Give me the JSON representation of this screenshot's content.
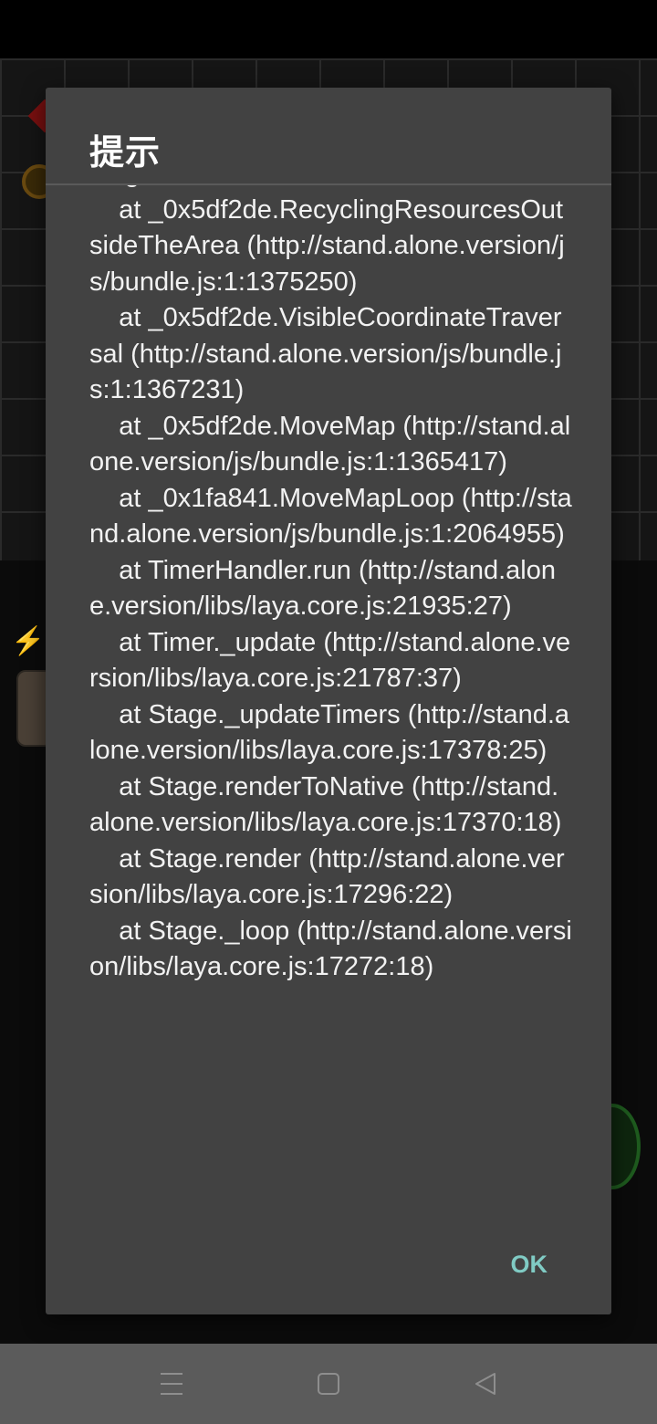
{
  "dialog": {
    "title": "提示",
    "message": "length of undefined\n    at _0x5df2de.RecyclingResourcesOutsideTheArea (http://stand.alone.version/js/bundle.js:1:1375250)\n    at _0x5df2de.VisibleCoordinateTraversal (http://stand.alone.version/js/bundle.js:1:1367231)\n    at _0x5df2de.MoveMap (http://stand.alone.version/js/bundle.js:1:1365417)\n    at _0x1fa841.MoveMapLoop (http://stand.alone.version/js/bundle.js:1:2064955)\n    at TimerHandler.run (http://stand.alone.version/libs/laya.core.js:21935:27)\n    at Timer._update (http://stand.alone.version/libs/laya.core.js:21787:37)\n    at Stage._updateTimers (http://stand.alone.version/libs/laya.core.js:17378:25)\n    at Stage.renderToNative (http://stand.alone.version/libs/laya.core.js:17370:18)\n    at Stage.render (http://stand.alone.version/libs/laya.core.js:17296:22)\n    at Stage._loop (http://stand.alone.version/libs/laya.core.js:17272:18)",
    "ok_label": "OK"
  },
  "nav_bar": {
    "menu_icon": "menu-icon",
    "home_icon": "home-icon",
    "back_icon": "back-icon"
  },
  "colors": {
    "dialog_bg": "#424242",
    "accent": "#80cbc4",
    "text": "#f2f2f2",
    "nav_bg": "#5b5b5b"
  }
}
